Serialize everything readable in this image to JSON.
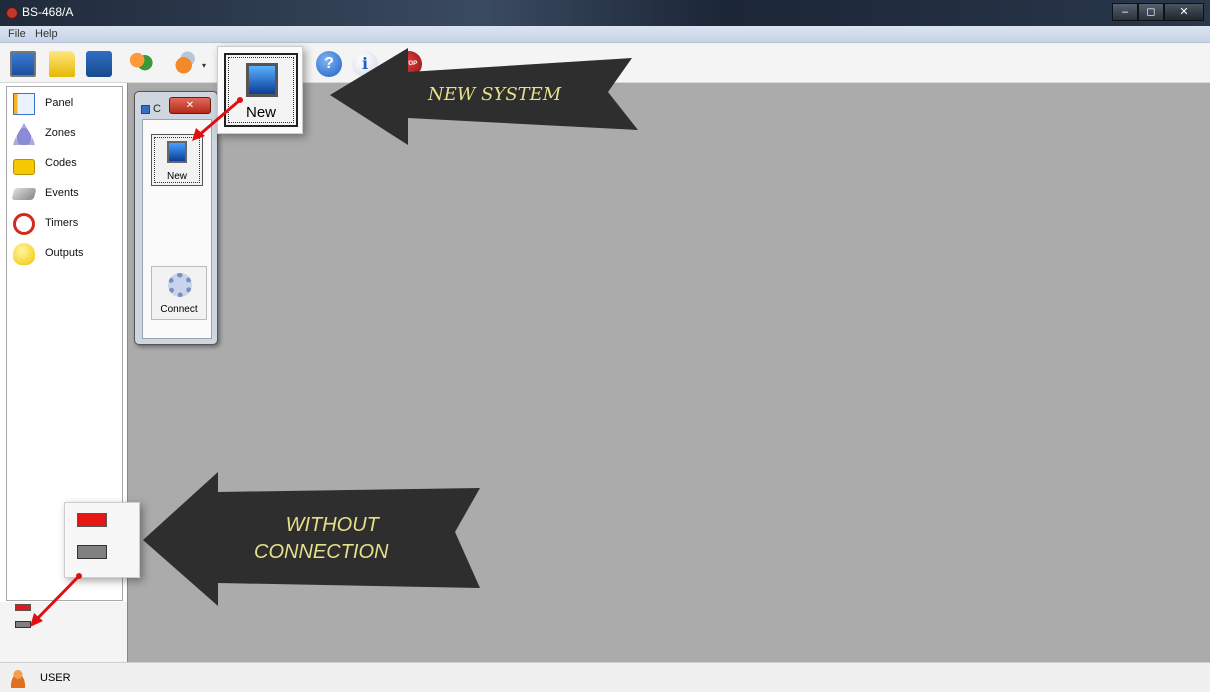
{
  "window": {
    "title": "BS-468/A",
    "minimize": "–",
    "maximize": "◻",
    "close": "✕"
  },
  "menu": {
    "file": "File",
    "help": "Help"
  },
  "toolbar": {
    "help_glyph": "?",
    "info_glyph": "i",
    "stop_label": "STOP",
    "dropdown_glyph": "▾"
  },
  "sidebar": {
    "items": [
      {
        "label": "Panel",
        "icon": "panel-icon"
      },
      {
        "label": "Zones",
        "icon": "zones-icon"
      },
      {
        "label": "Codes",
        "icon": "lock-icon"
      },
      {
        "label": "Events",
        "icon": "events-icon"
      },
      {
        "label": "Timers",
        "icon": "alarm-clock-icon"
      },
      {
        "label": "Outputs",
        "icon": "lightbulb-icon"
      }
    ]
  },
  "connect_window": {
    "title": "C",
    "close_glyph": "✕",
    "new_label": "New",
    "connect_label": "Connect"
  },
  "callouts": {
    "new_label": "New"
  },
  "annotations": {
    "new_system": "NEW SYSTEM",
    "without_connection_1": "WITHOUT",
    "without_connection_2": "CONNECTION"
  },
  "status": {
    "user_label": "USER"
  },
  "colors": {
    "led_red": "#e81515",
    "led_gray": "#808080",
    "main_area": "#ababab",
    "annotation_arrow": "#2e2e2e",
    "annotation_text": "#e8df8a"
  }
}
